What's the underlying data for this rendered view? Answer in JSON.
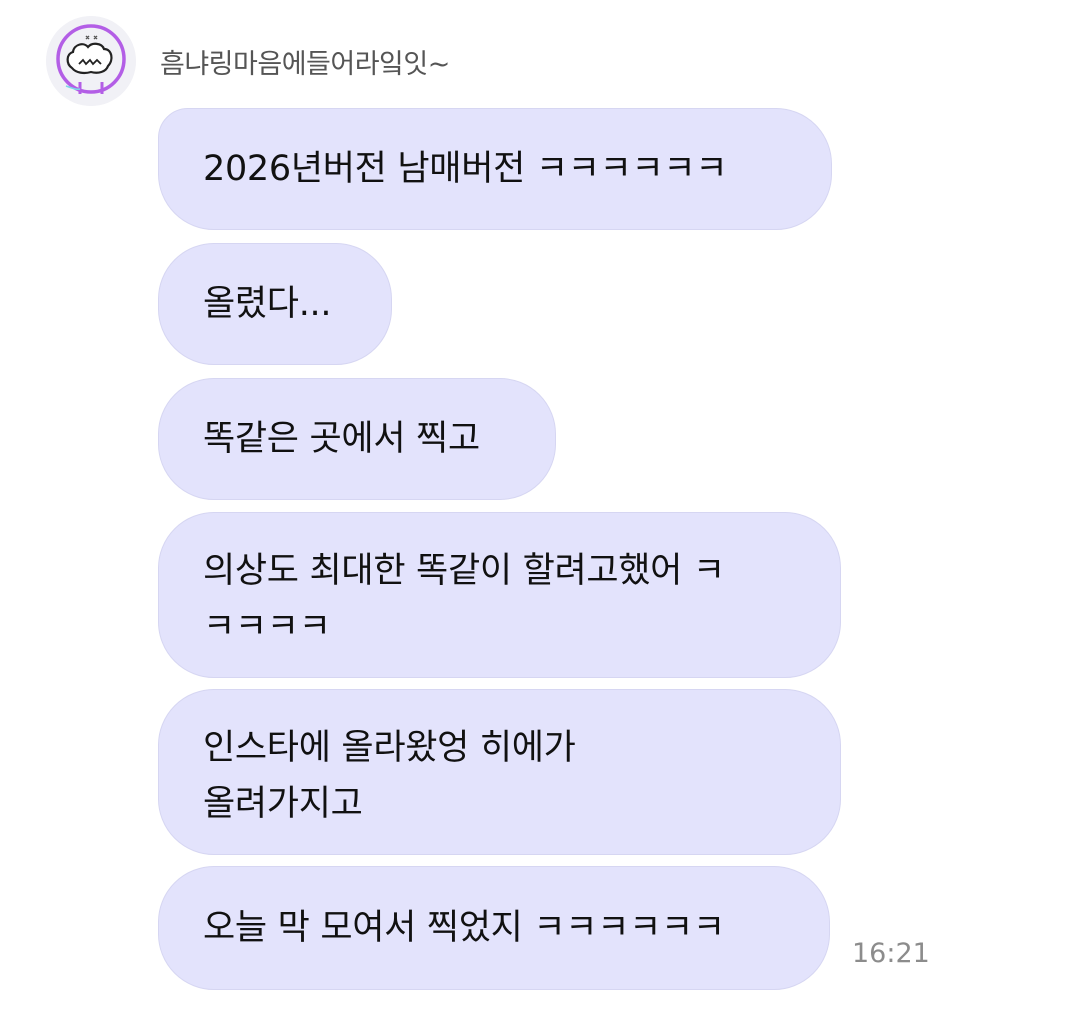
{
  "chat": {
    "sender_name": "흠냐링마음에들어라잌잇~",
    "avatar_icon": "cartoon-character-icon",
    "bubble_color": "#e3e3fc",
    "messages": [
      {
        "text": "2026년버전 남매버전 ㅋㅋㅋㅋㅋㅋ"
      },
      {
        "text": "올렸다..."
      },
      {
        "text": "똑같은 곳에서 찍고"
      },
      {
        "line1": "의상도 최대한 똑같이 할려고했어 ㅋ",
        "line2": "ㅋㅋㅋㅋ"
      },
      {
        "line1": "인스타에 올라왔엉 히에가",
        "line2": "올려가지고"
      },
      {
        "text": "오늘 막 모여서 찍었지 ㅋㅋㅋㅋㅋㅋ"
      }
    ],
    "timestamp": "16:21"
  }
}
